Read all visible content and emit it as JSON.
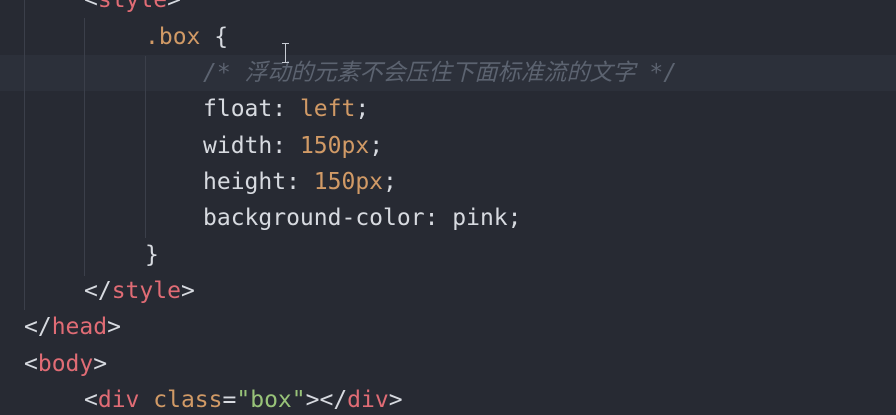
{
  "editor": {
    "lines": [
      {
        "open": "<",
        "tag": "style",
        "close": ">"
      },
      {
        "selector": ".box",
        "brace": " {"
      },
      {
        "comment": "/* 浮动的元素不会压住下面标准流的文字 */"
      },
      {
        "prop": "float",
        "sep": ": ",
        "value": "left",
        "end": ";"
      },
      {
        "prop": "width",
        "sep": ": ",
        "value": "150px",
        "end": ";"
      },
      {
        "prop": "height",
        "sep": ": ",
        "value": "150px",
        "end": ";"
      },
      {
        "prop": "background-color",
        "sep": ": ",
        "value": "pink",
        "end": ";"
      },
      {
        "brace": "}"
      },
      {
        "open": "</",
        "tag": "style",
        "close": ">"
      },
      {
        "open": "</",
        "tag": "head",
        "close": ">"
      },
      {
        "open": "<",
        "tag": "body",
        "close": ">"
      },
      {
        "open": "<",
        "tag": "div",
        "attr": "class",
        "eq": "=",
        "str": "\"box\"",
        "mid": "></",
        "tag2": "div",
        "close": ">"
      }
    ]
  },
  "colors": {
    "background": "#272a33",
    "tag": "#e06c75",
    "number": "#d19a66",
    "string": "#98c379",
    "comment": "#5c6370"
  }
}
